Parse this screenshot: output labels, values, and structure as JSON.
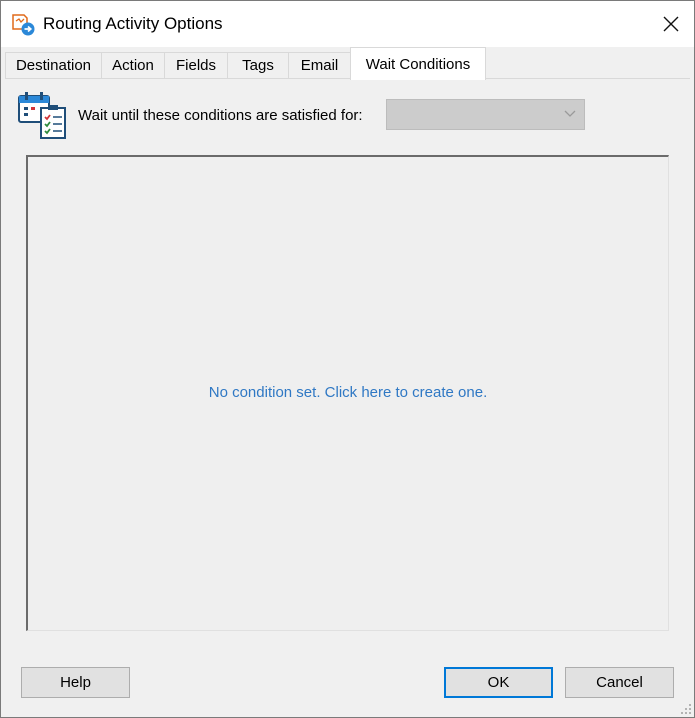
{
  "window": {
    "title": "Routing Activity Options"
  },
  "tabs": [
    {
      "label": "Destination"
    },
    {
      "label": "Action"
    },
    {
      "label": "Fields"
    },
    {
      "label": "Tags"
    },
    {
      "label": "Email"
    },
    {
      "label": "Wait Conditions",
      "active": true
    }
  ],
  "wait": {
    "label": "Wait until these conditions are satisfied for:",
    "selected_value": ""
  },
  "conditions": {
    "empty_message": "No condition set. Click here to create one."
  },
  "buttons": {
    "help": "Help",
    "ok": "OK",
    "cancel": "Cancel"
  },
  "colors": {
    "link": "#2f78c4",
    "default_button_border": "#0078d7"
  },
  "icons": [
    "routing-activity-icon",
    "close-icon",
    "calendar-checklist-icon",
    "chevron-down-icon",
    "resize-grip-icon"
  ]
}
